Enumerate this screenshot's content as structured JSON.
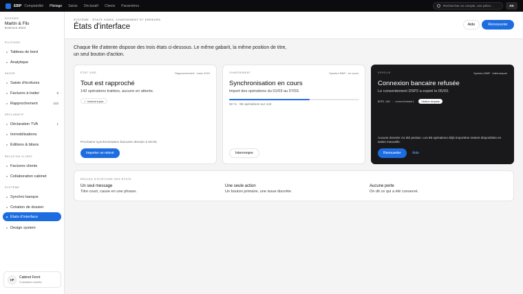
{
  "topbar": {
    "brand": "EBP",
    "brand_sub": "Comptabilité",
    "nav": [
      "Pilotage",
      "Saisie",
      "Déclaratif",
      "Clients",
      "Paramètres"
    ],
    "active_nav": "Pilotage",
    "search_placeholder": "Rechercher un compte, une pièce...",
    "avatar": "AK"
  },
  "sidebar": {
    "org_label": "DOSSIER",
    "org_name": "Martin & Fils",
    "org_year": "Exercice 2024",
    "sections": [
      {
        "title": "PILOTAGE",
        "items": [
          {
            "label": "Tableau de bord",
            "count": ""
          },
          {
            "label": "Analytique",
            "count": ""
          }
        ]
      },
      {
        "title": "SAISIE",
        "items": [
          {
            "label": "Saisie d'écritures",
            "count": ""
          },
          {
            "label": "Factures à traiter",
            "count": "8"
          },
          {
            "label": "Rapprochement",
            "count": "142"
          }
        ]
      },
      {
        "title": "DÉCLARATIF",
        "items": [
          {
            "label": "Déclaration TVA",
            "count": "1"
          },
          {
            "label": "Immobilisations",
            "count": ""
          },
          {
            "label": "Éditions & bilans",
            "count": ""
          }
        ]
      },
      {
        "title": "RELATION CLIENT",
        "items": [
          {
            "label": "Factures clients",
            "count": ""
          },
          {
            "label": "Collaboration cabinet",
            "count": ""
          }
        ]
      },
      {
        "title": "SYSTÈME",
        "items": [
          {
            "label": "Synchro banque",
            "count": ""
          },
          {
            "label": "Création de dossier",
            "count": ""
          },
          {
            "label": "États d'interface",
            "count": "",
            "active": true
          },
          {
            "label": "Design system",
            "count": ""
          }
        ]
      }
    ],
    "account": {
      "initials": "CF",
      "name": "Cabinet Ferré",
      "sub": "3 dossiers ouverts"
    }
  },
  "header": {
    "breadcrumb": "SYSTÈME · ÉTATS VIDES, CHARGEMENT ET ERREURS",
    "title": "États d'interface",
    "help": "Aide",
    "renew": "Renouveler"
  },
  "intro": "Chaque file d'attente dispose des trois états ci-dessous. Le même gabarit, la même position de titre, un seul bouton d'action.",
  "cards": {
    "empty": {
      "tag": "ÉTAT VIDE",
      "meta": "Rapprochement · mars 2024",
      "title": "Tout est rapproché",
      "desc": "142 opérations traitées, aucune en attente.",
      "badge": "✓ Journal à jour",
      "foot": "Prochaine synchronisation bancaire demain à 06:00.",
      "button": "Importer un relevé"
    },
    "loading": {
      "tag": "CHARGEMENT",
      "meta": "Synchro BNP · en cours",
      "title": "Synchronisation en cours",
      "desc": "Import des opérations du 01/03 au 07/03.",
      "progress": 0.62,
      "progress_text": "62 % · 88 opérations sur 142",
      "button": "Interrompre"
    },
    "error": {
      "tag": "ERREUR",
      "meta": "Synchro BNP · interrompue",
      "title": "Connexion bancaire refusée",
      "desc": "Le consentement DSP2 a expiré le 05/03.",
      "code": "DSP2-401 · consentement",
      "pill": "! Action requise",
      "foot": "Aucune donnée n'a été perdue. Les 88 opérations déjà importées restent disponibles en saisie manuelle.",
      "button": "Renouveler",
      "help": "Aide"
    }
  },
  "rules": {
    "tag": "RÈGLES D'ÉCRITURE DES ÉTATS",
    "items": [
      {
        "heading": "Un seul message",
        "text": "Titre court, cause en une phrase."
      },
      {
        "heading": "Une seule action",
        "text": "Un bouton primaire, une issue discrète."
      },
      {
        "heading": "Aucune perte",
        "text": "On dit ce qui a été conservé."
      }
    ]
  }
}
